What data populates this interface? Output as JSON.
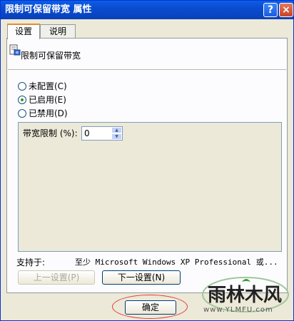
{
  "window": {
    "title": "限制可保留带宽 属性",
    "help_glyph": "?",
    "close_glyph": "×"
  },
  "tabs": [
    {
      "label": "设置"
    },
    {
      "label": "说明"
    }
  ],
  "policy": {
    "icon": "policy-setting-icon",
    "name": "限制可保留带宽"
  },
  "options": [
    {
      "label": "未配置(C)",
      "selected": false
    },
    {
      "label": "已启用(E)",
      "selected": true
    },
    {
      "label": "已禁用(D)",
      "selected": false
    }
  ],
  "bandwidth": {
    "label": "带宽限制 (%):",
    "value": "0"
  },
  "support": {
    "label": "支持于:",
    "text": "至少 Microsoft Windows XP Professional 或..."
  },
  "buttons": {
    "prev": "上一设置(P)",
    "next": "下一设置(N)",
    "ok": "确定"
  },
  "watermark": {
    "text": "雨林木风",
    "url": "www.YLMFU.com"
  },
  "colors": {
    "titlebar": "#0a4bd0",
    "dialog_bg": "#ece9d8",
    "annotation": "#e23a3a"
  }
}
